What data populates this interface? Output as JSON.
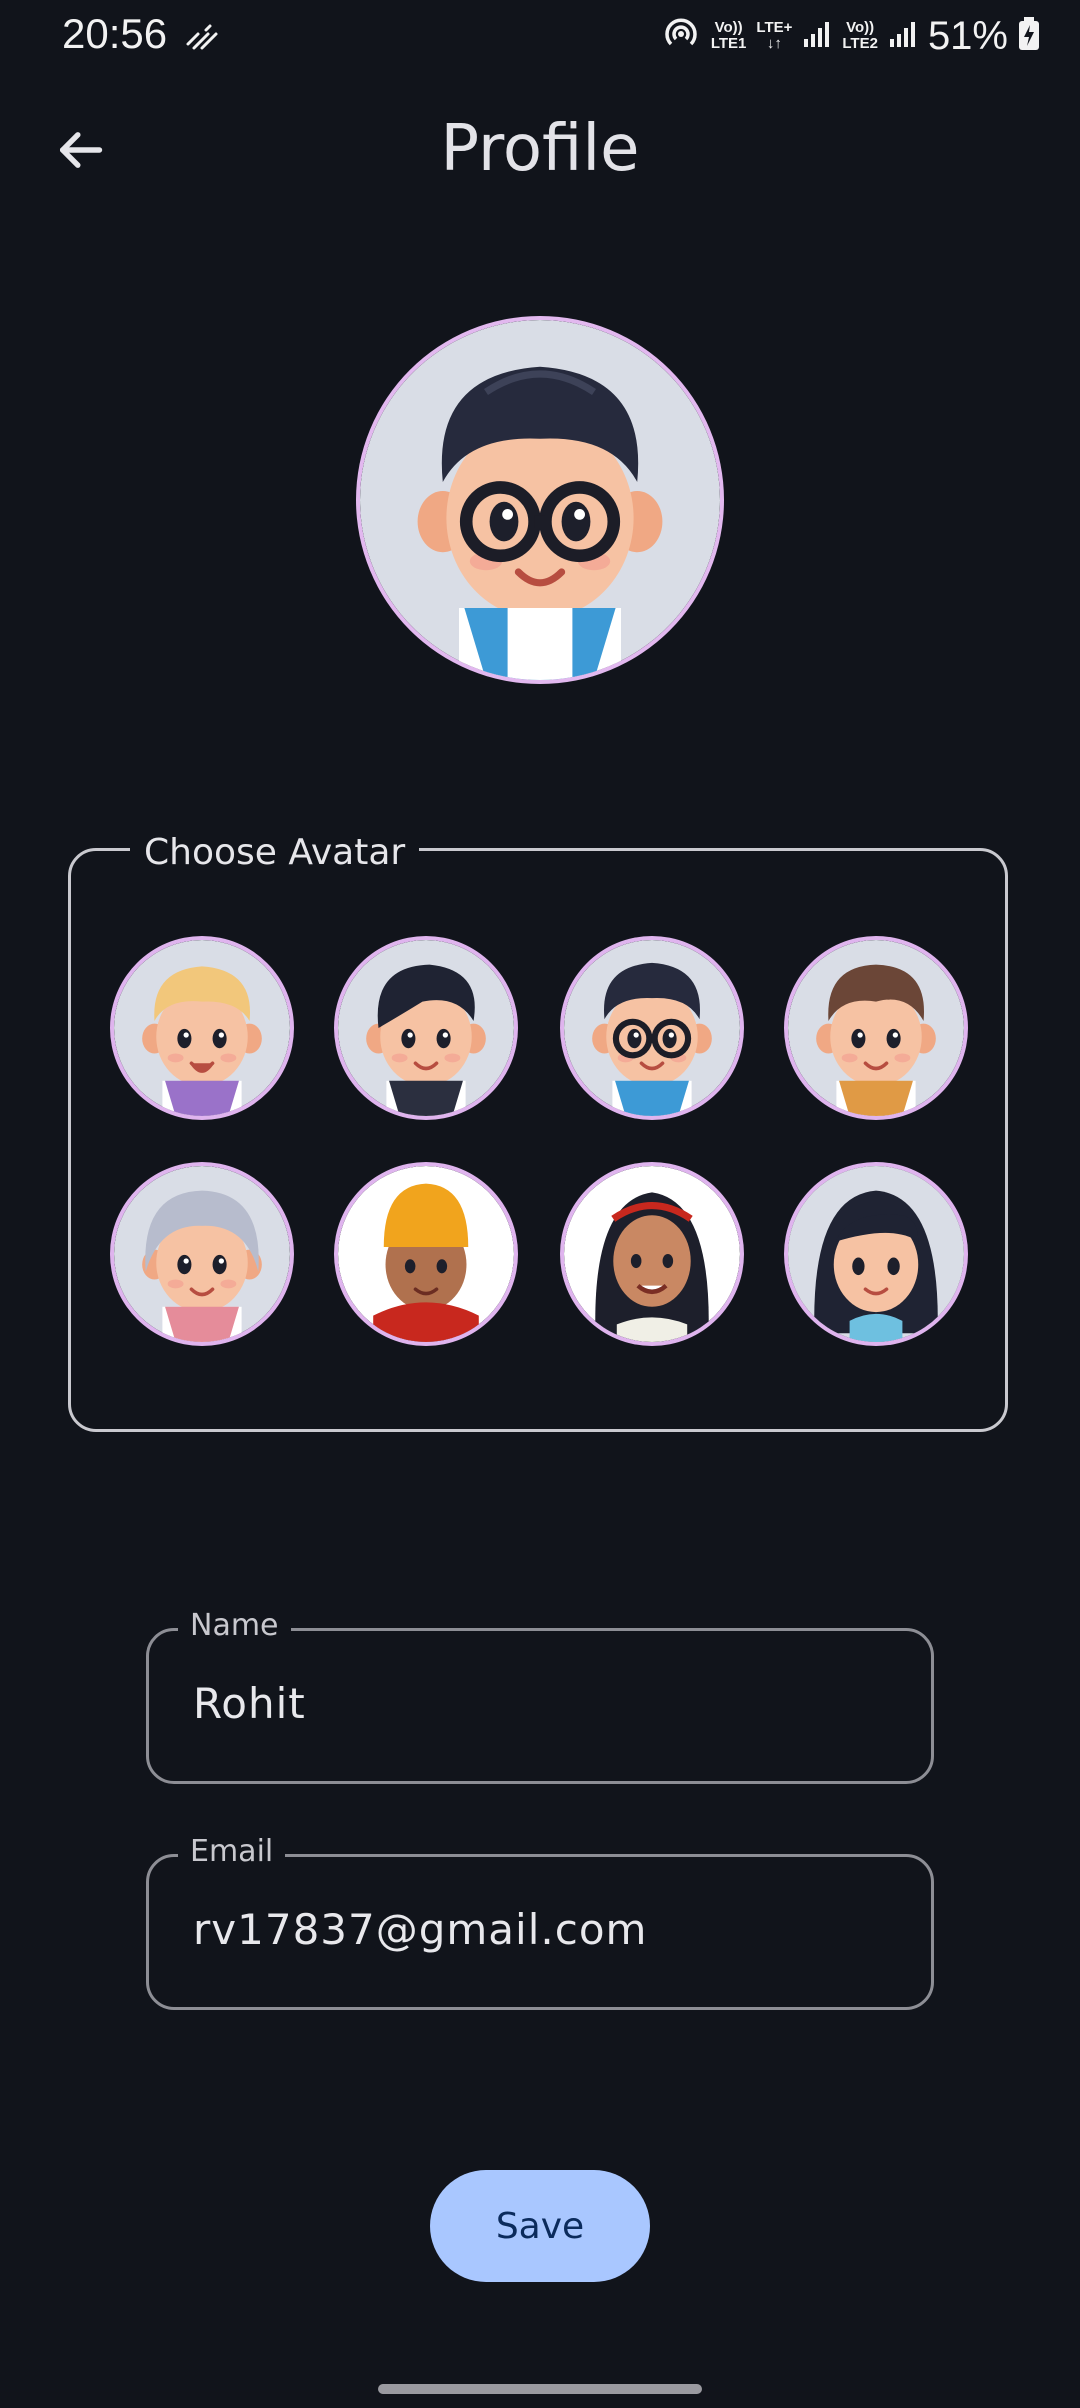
{
  "status_bar": {
    "time": "20:56",
    "sim1_label_top": "Vo))",
    "sim1_label_bottom": "LTE1",
    "net_type": "LTE+",
    "sim2_label_top": "Vo))",
    "sim2_label_bottom": "LTE2",
    "battery": "51%"
  },
  "header": {
    "title": "Profile"
  },
  "avatar_picker": {
    "legend": "Choose Avatar",
    "options": [
      {
        "name": "avatar-blond-boy"
      },
      {
        "name": "avatar-black-hair-boy"
      },
      {
        "name": "avatar-glasses-boy"
      },
      {
        "name": "avatar-brown-hair-boy"
      },
      {
        "name": "avatar-grey-hair"
      },
      {
        "name": "avatar-beanie"
      },
      {
        "name": "avatar-long-hair-girl"
      },
      {
        "name": "avatar-bob-hair-girl"
      }
    ]
  },
  "form": {
    "name_label": "Name",
    "name_value": "Rohit",
    "email_label": "Email",
    "email_value": "rv17837@gmail.com"
  },
  "actions": {
    "save_label": "Save"
  },
  "colors": {
    "background": "#11141b",
    "accent_button": "#a9c7ff",
    "avatar_ring": "#dfb4ee"
  }
}
